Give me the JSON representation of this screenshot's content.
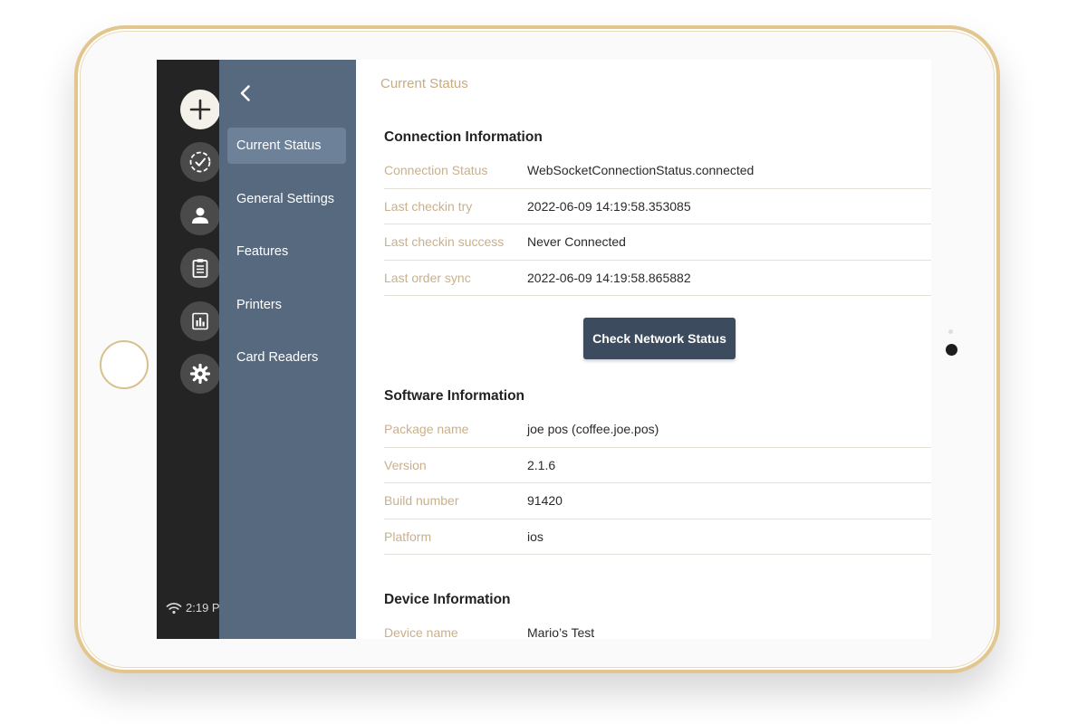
{
  "status_bar": {
    "time": "2:19 P"
  },
  "rail": {
    "items": [
      {
        "icon": "plus-icon"
      },
      {
        "icon": "check-circle-icon"
      },
      {
        "icon": "person-icon"
      },
      {
        "icon": "clipboard-icon"
      },
      {
        "icon": "bar-chart-icon"
      },
      {
        "icon": "gear-icon"
      }
    ]
  },
  "settings_nav": {
    "back_icon": "chevron-left-icon",
    "items": [
      {
        "label": "Current Status",
        "active": true
      },
      {
        "label": "General Settings",
        "active": false
      },
      {
        "label": "Features",
        "active": false
      },
      {
        "label": "Printers",
        "active": false
      },
      {
        "label": "Card Readers",
        "active": false
      }
    ]
  },
  "main": {
    "title": "Current Status",
    "connection": {
      "title": "Connection Information",
      "rows": [
        {
          "label": "Connection Status",
          "value": "WebSocketConnectionStatus.connected"
        },
        {
          "label": "Last checkin try",
          "value": "2022-06-09 14:19:58.353085"
        },
        {
          "label": "Last checkin success",
          "value": "Never Connected"
        },
        {
          "label": "Last order sync",
          "value": "2022-06-09 14:19:58.865882"
        }
      ]
    },
    "check_button": "Check Network Status",
    "software": {
      "title": "Software Information",
      "rows": [
        {
          "label": "Package name",
          "value": "joe pos (coffee.joe.pos)"
        },
        {
          "label": "Version",
          "value": "2.1.6"
        },
        {
          "label": "Build number",
          "value": "91420"
        },
        {
          "label": "Platform",
          "value": "ios"
        }
      ]
    },
    "device": {
      "title": "Device Information",
      "rows": [
        {
          "label": "Device name",
          "value": "Mario’s Test"
        }
      ]
    }
  },
  "colors": {
    "rail_bg": "#242424",
    "panel_bg": "#56697f",
    "panel_active": "#6d8198",
    "label_gold": "#c9b08c",
    "button_bg": "#3c4c5e",
    "frame_gold": "#e2c68e"
  }
}
